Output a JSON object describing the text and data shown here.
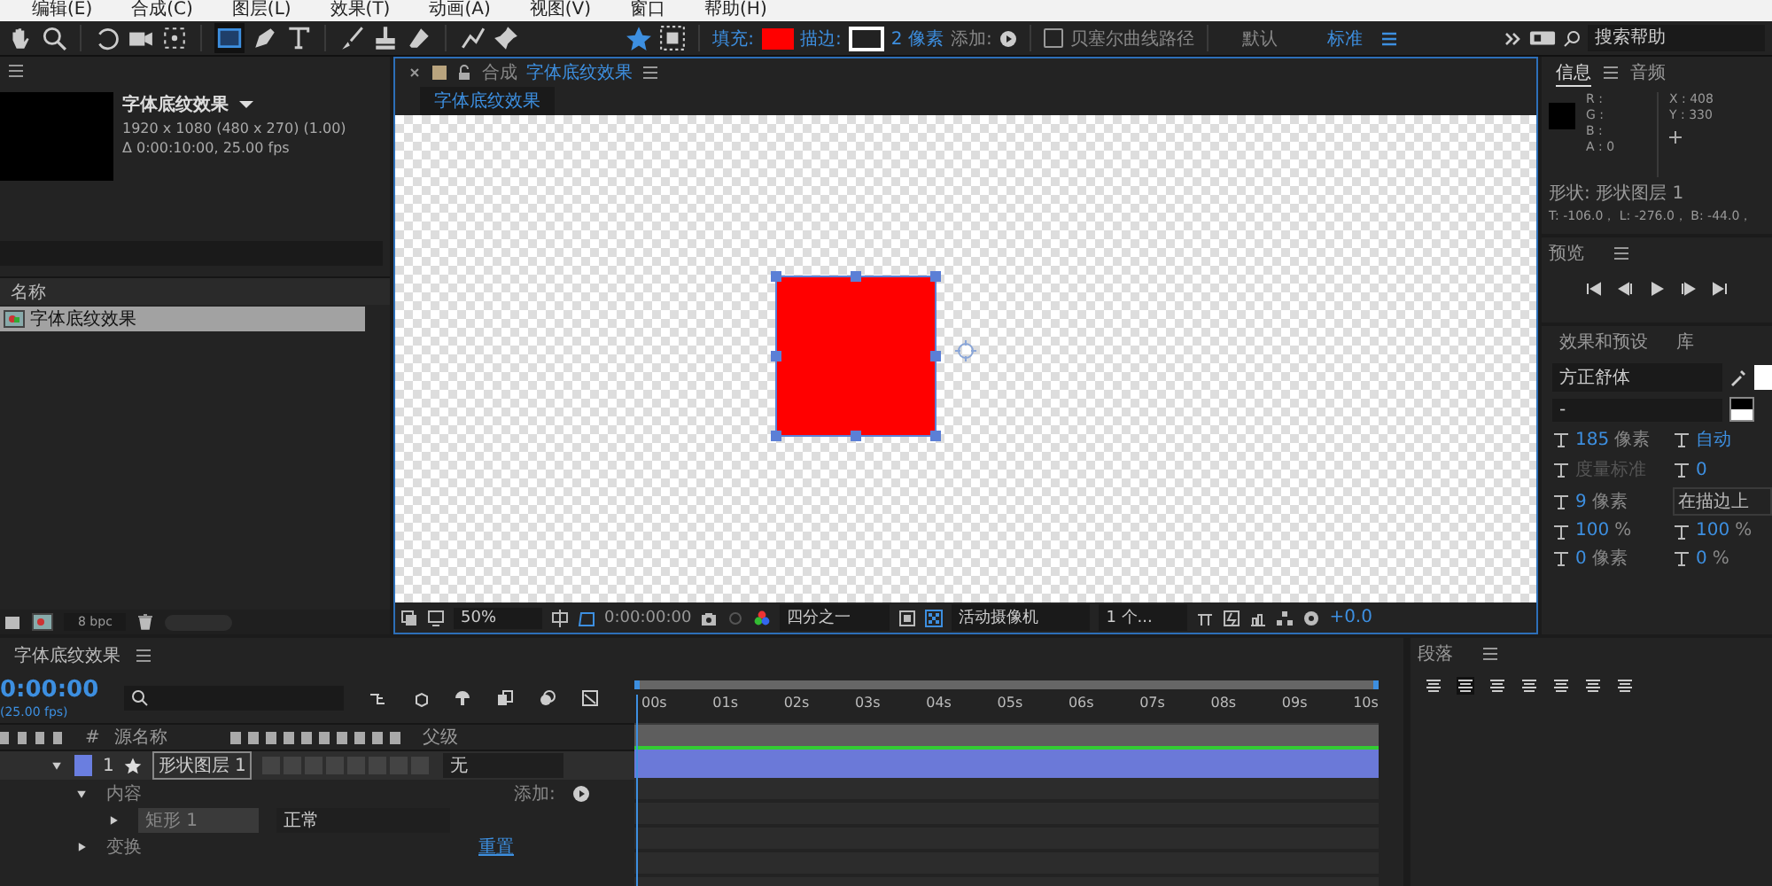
{
  "menu": [
    "编辑(E)",
    "合成(C)",
    "图层(L)",
    "效果(T)",
    "动画(A)",
    "视图(V)",
    "窗口",
    "帮助(H)"
  ],
  "toolbar": {
    "fill_label": "填充:",
    "stroke_label": "描边:",
    "stroke_width": "2 像素",
    "add_label": "添加:",
    "bezier": {
      "label": "贝塞尔曲线路径",
      "checked": false
    },
    "workspaces": [
      {
        "label": "默认",
        "selected": false
      },
      {
        "label": "标准",
        "selected": true
      }
    ],
    "search": {
      "placeholder": "搜索帮助"
    }
  },
  "project": {
    "comp_name": "字体底纹效果",
    "resolution": "1920 x 1080  (480 x 270) (1.00)",
    "duration": "Δ 0:00:10:00, 25.00 fps",
    "column": "名称",
    "items": [
      {
        "name": "字体底纹效果",
        "selected": true
      }
    ],
    "bpc": "8 bpc"
  },
  "viewer": {
    "tab_prefix": "合成",
    "tab_title": "字体底纹效果",
    "breadcrumb": "字体底纹效果",
    "zoom": "50%",
    "time": "0:00:00:00",
    "resolution": "四分之一",
    "camera": "活动摄像机",
    "views": "1 个...",
    "exposure": "+0.0"
  },
  "info": {
    "tabs": [
      {
        "label": "信息",
        "selected": true
      },
      {
        "label": "音频",
        "selected": false
      }
    ],
    "channels": [
      "R :",
      "G :",
      "B :",
      "A : 0"
    ],
    "coords": [
      "X : 408",
      "Y : 330"
    ],
    "shape": "形状: 形状图层 1",
    "bounds": "T: -106.0， L: -276.0， B: -44.0，"
  },
  "preview": {
    "title": "预览"
  },
  "character": {
    "tabs": [
      {
        "label": "效果和预设",
        "selected": false
      },
      {
        "label": "库",
        "selected": false
      }
    ],
    "font": "方正舒体",
    "style": "-",
    "rows": [
      {
        "value": "185",
        "unit": "像素"
      },
      {
        "value": "自动",
        "unit": ""
      },
      {
        "value": "",
        "unit": "度量标准"
      },
      {
        "value": "0",
        "unit": ""
      },
      {
        "value": "9",
        "unit": "像素"
      },
      {
        "value": "",
        "unit": "在描边上"
      },
      {
        "value": "100",
        "unit": "%"
      },
      {
        "value": "100",
        "unit": "%"
      },
      {
        "value": "0",
        "unit": "像素"
      },
      {
        "value": "0",
        "unit": "%"
      }
    ]
  },
  "timeline": {
    "tab": "字体底纹效果",
    "time": "0:00:00",
    "fps": "(25.00 fps)",
    "columns": [
      "#",
      "源名称",
      "父级"
    ],
    "layer": {
      "number": "1",
      "name": "形状图层 1",
      "parent": "无",
      "expanded": true,
      "children": [
        {
          "label": "内容",
          "expanded": true,
          "extra": "添加:",
          "children": [
            {
              "label": "矩形 1",
              "expanded": false,
              "mode": "正常"
            }
          ]
        },
        {
          "label": "变换",
          "expanded": false,
          "link": "重置"
        }
      ]
    },
    "ruler": [
      "00s",
      "01s",
      "02s",
      "03s",
      "04s",
      "05s",
      "06s",
      "07s",
      "08s",
      "09s",
      "10s"
    ]
  },
  "paragraph": {
    "title": "段落"
  }
}
